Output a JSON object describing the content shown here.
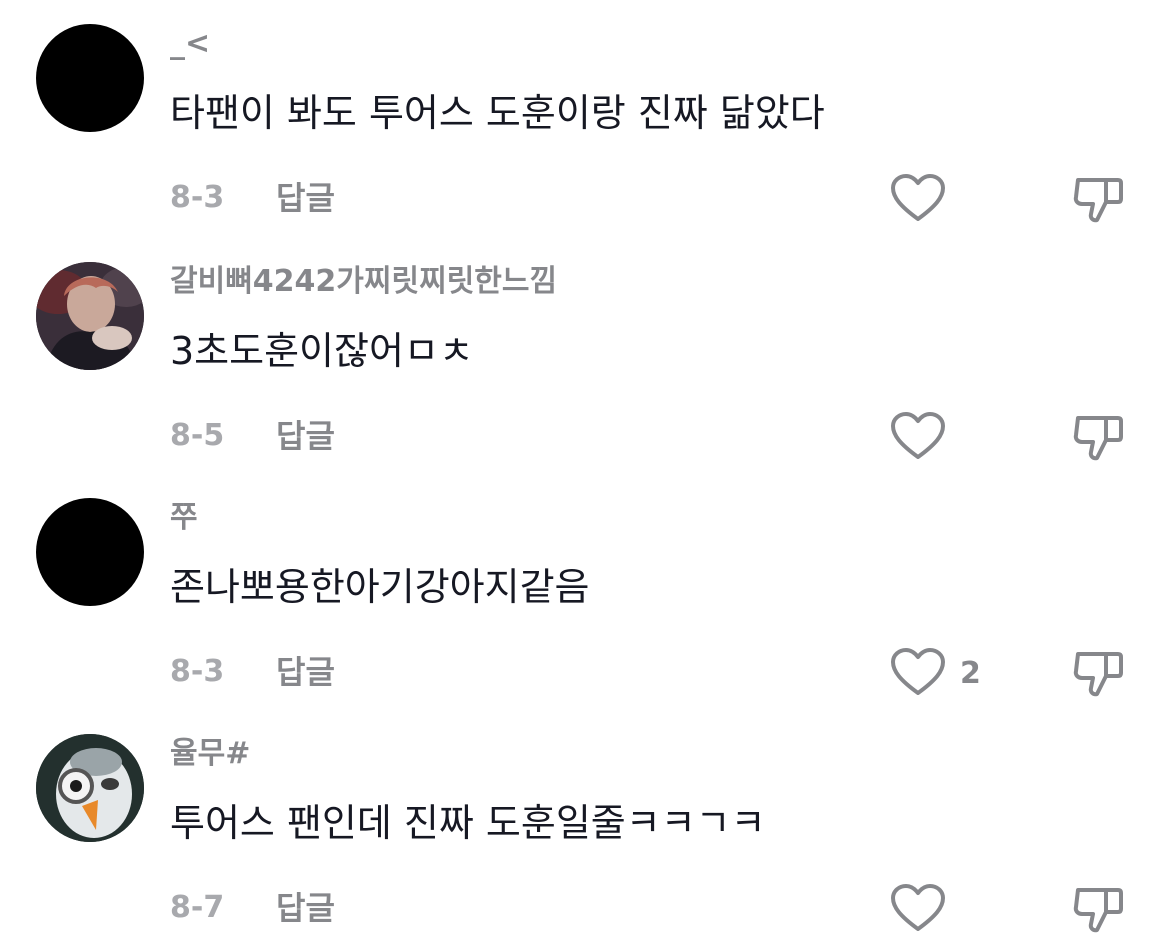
{
  "comments": [
    {
      "username": "_<",
      "text": "타팬이 봐도 투어스 도훈이랑 진짜 닮았다",
      "date": "8-3",
      "reply_label": "답글",
      "likes": ""
    },
    {
      "username": "갈비뼈4242가찌릿찌릿한느낌",
      "text": "3초도훈이잖어ㅁㅊ",
      "date": "8-5",
      "reply_label": "답글",
      "likes": ""
    },
    {
      "username": "쭈",
      "text": "존나뽀용한아기강아지같음",
      "date": "8-3",
      "reply_label": "답글",
      "likes": "2"
    },
    {
      "username": "율무#",
      "text": "투어스 팬인데 진짜 도훈일줄ㅋㅋㄱㅋ",
      "date": "8-7",
      "reply_label": "답글",
      "likes": ""
    }
  ],
  "icons": {
    "like": "heart-outline-icon",
    "dislike": "thumbs-down-outline-icon"
  },
  "colors": {
    "primary_text": "#161823",
    "secondary_text": "#86878b",
    "date_text": "#a8a9ad",
    "icon": "#86878b"
  }
}
